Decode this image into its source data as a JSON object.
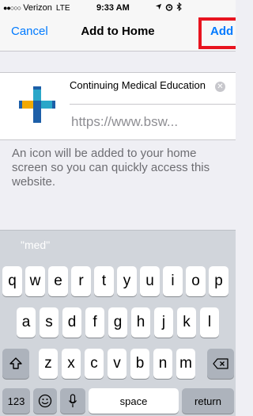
{
  "status_bar": {
    "signal": "●●○○○",
    "carrier": "Verizon",
    "network": "LTE",
    "time": "9:33 AM"
  },
  "nav": {
    "cancel_label": "Cancel",
    "title": "Add to Home",
    "add_label": "Add"
  },
  "form": {
    "name_value": "Continuing Medical Education",
    "url": "https://www.bsw..."
  },
  "description": "An icon will be added to your home screen so you can quickly access this website.",
  "keyboard": {
    "suggestion": "\"med\"",
    "row1": [
      "q",
      "w",
      "e",
      "r",
      "t",
      "y",
      "u",
      "i",
      "o",
      "p"
    ],
    "row2": [
      "a",
      "s",
      "d",
      "f",
      "g",
      "h",
      "j",
      "k",
      "l"
    ],
    "row3": [
      "z",
      "x",
      "c",
      "v",
      "b",
      "n",
      "m"
    ],
    "numbers_label": "123",
    "space_label": "space",
    "return_label": "return",
    "shift_icon": "shift-icon",
    "delete_icon": "delete-icon",
    "emoji_icon": "emoji-icon",
    "mic_icon": "microphone-icon"
  },
  "colors": {
    "accent": "#007aff",
    "highlight": "#e8141f",
    "logo_blue": "#1d5fa8",
    "logo_yellow": "#f2a900",
    "logo_teal": "#2aa7c9"
  }
}
